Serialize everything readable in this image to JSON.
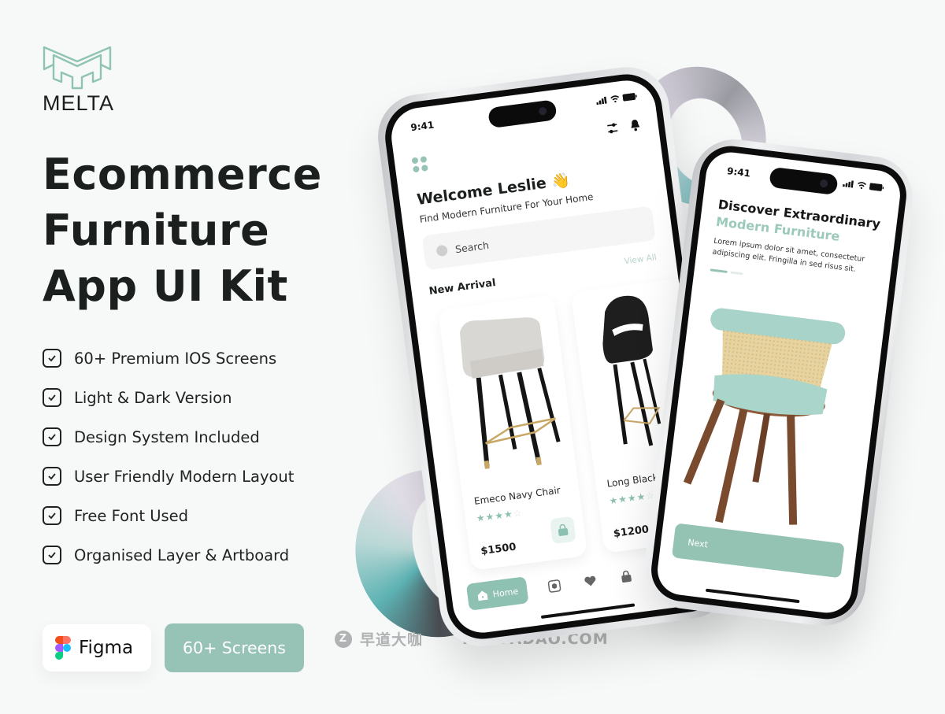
{
  "brand": {
    "name": "MELTA",
    "accent_color": "#97c3b6"
  },
  "headline": {
    "lines": [
      "Ecommerce",
      "Furniture",
      "App UI Kit"
    ]
  },
  "features": [
    {
      "label": "60+ Premium IOS Screens",
      "icon": "checkbox-icon"
    },
    {
      "label": "Light & Dark Version",
      "icon": "checkbox-icon"
    },
    {
      "label": "Design System Included",
      "icon": "checkbox-icon"
    },
    {
      "label": "User Friendly Modern Layout",
      "icon": "checkbox-icon"
    },
    {
      "label": "Free Font Used",
      "icon": "checkbox-icon"
    },
    {
      "label": "Organised Layer & Artboard",
      "icon": "checkbox-icon"
    }
  ],
  "badges": {
    "figma_label": "Figma",
    "screens_label": "60+ Screens"
  },
  "watermark": {
    "text": "早道大咖",
    "domain": "IAMDADAO.COM"
  },
  "phone_home": {
    "time": "9:41",
    "welcome": "Welcome Leslie 👋",
    "subtitle": "Find Modern Furniture For Your Home",
    "search_placeholder": "Search",
    "section_title": "New Arrival",
    "view_all": "View All",
    "products": [
      {
        "name": "Emeco Navy Chair",
        "rating": 4,
        "max_rating": 5,
        "price": "$1500"
      },
      {
        "name": "Long Black Chair",
        "rating": 4,
        "max_rating": 5,
        "price": "$1200"
      }
    ],
    "tabbar": {
      "home_label": "Home",
      "icons": [
        "home-icon",
        "box-icon",
        "heart-icon",
        "bag-icon",
        "profile-icon"
      ]
    }
  },
  "phone_onboarding": {
    "time": "9:41",
    "title": "Discover Extraordinary",
    "title_accent": "Modern Furniture",
    "body": "Lorem ipsum dolor sit amet, consectetur adipiscing elit. Fringilla in sed risus sit.",
    "page_index": 1,
    "page_count": 3,
    "next_label": "Next"
  }
}
